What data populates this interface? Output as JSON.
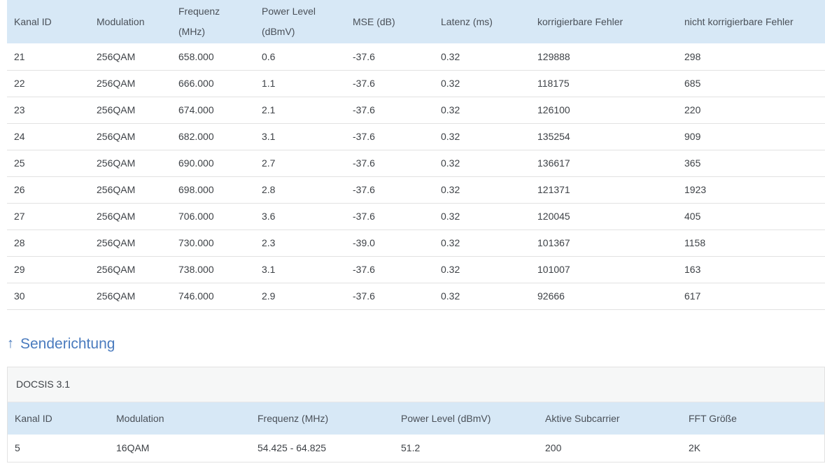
{
  "downstream_table": {
    "columns": [
      "Kanal ID",
      "Modulation",
      "Frequenz (MHz)",
      "Power Level (dBmV)",
      "MSE (dB)",
      "Latenz (ms)",
      "korrigierbare Fehler",
      "nicht korrigierbare Fehler"
    ],
    "rows": [
      [
        "21",
        "256QAM",
        "658.000",
        "0.6",
        "-37.6",
        "0.32",
        "129888",
        "298"
      ],
      [
        "22",
        "256QAM",
        "666.000",
        "1.1",
        "-37.6",
        "0.32",
        "118175",
        "685"
      ],
      [
        "23",
        "256QAM",
        "674.000",
        "2.1",
        "-37.6",
        "0.32",
        "126100",
        "220"
      ],
      [
        "24",
        "256QAM",
        "682.000",
        "3.1",
        "-37.6",
        "0.32",
        "135254",
        "909"
      ],
      [
        "25",
        "256QAM",
        "690.000",
        "2.7",
        "-37.6",
        "0.32",
        "136617",
        "365"
      ],
      [
        "26",
        "256QAM",
        "698.000",
        "2.8",
        "-37.6",
        "0.32",
        "121371",
        "1923"
      ],
      [
        "27",
        "256QAM",
        "706.000",
        "3.6",
        "-37.6",
        "0.32",
        "120045",
        "405"
      ],
      [
        "28",
        "256QAM",
        "730.000",
        "2.3",
        "-39.0",
        "0.32",
        "101367",
        "1158"
      ],
      [
        "29",
        "256QAM",
        "738.000",
        "3.1",
        "-37.6",
        "0.32",
        "101007",
        "163"
      ],
      [
        "30",
        "256QAM",
        "746.000",
        "2.9",
        "-37.6",
        "0.32",
        "92666",
        "617"
      ]
    ]
  },
  "upstream_section": {
    "arrow_icon": "↑",
    "heading": "Senderichtung",
    "group_label": "DOCSIS 3.1",
    "columns": [
      "Kanal ID",
      "Modulation",
      "Frequenz (MHz)",
      "Power Level (dBmV)",
      "Aktive Subcarrier",
      "FFT Größe"
    ],
    "rows": [
      [
        "5",
        "16QAM",
        "54.425 - 64.825",
        "51.2",
        "200",
        "2K"
      ]
    ]
  },
  "colors": {
    "table_header_bg": "#d7e8f6",
    "group_row_bg": "#f6f7f7",
    "row_border": "#e2e2e2",
    "heading_blue": "#4a7bbe",
    "text": "#3e4247"
  }
}
